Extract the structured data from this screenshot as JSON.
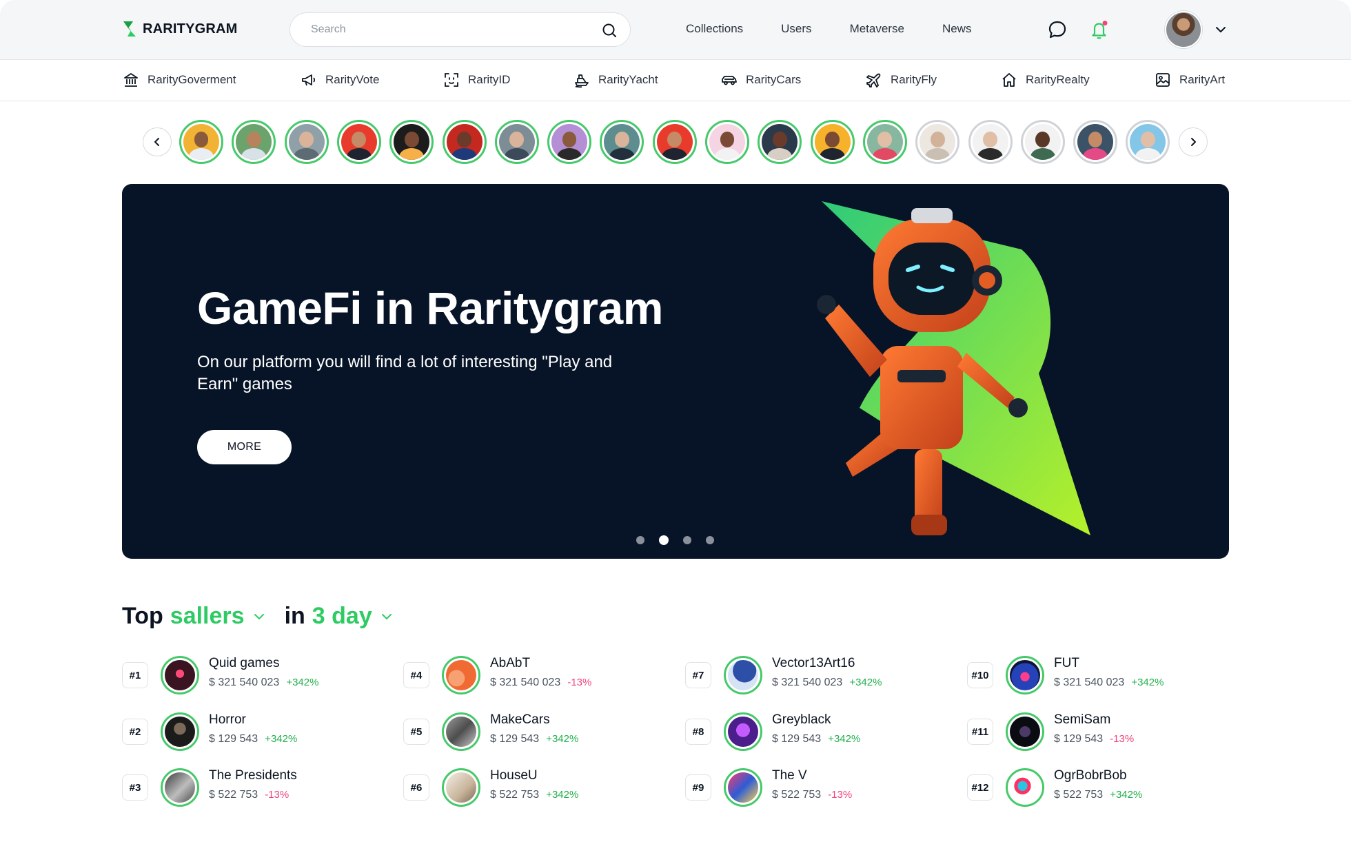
{
  "brand": {
    "name": "RARITYGRAM"
  },
  "search": {
    "placeholder": "Search"
  },
  "topnav": [
    "Collections",
    "Users",
    "Metaverse",
    "News"
  ],
  "categories": [
    {
      "label": "RarityGoverment",
      "icon": "bank-icon"
    },
    {
      "label": "RarityVote",
      "icon": "megaphone-icon"
    },
    {
      "label": "RarityID",
      "icon": "face-id-icon"
    },
    {
      "label": "RarityYacht",
      "icon": "yacht-icon"
    },
    {
      "label": "RarityCars",
      "icon": "car-icon"
    },
    {
      "label": "RarityFly",
      "icon": "plane-icon"
    },
    {
      "label": "RarityRealty",
      "icon": "house-icon"
    },
    {
      "label": "RarityArt",
      "icon": "picture-icon"
    }
  ],
  "stories_count": 19,
  "hero": {
    "title": "GameFi in Raritygram",
    "subtitle": "On our platform you will find a lot of interesting \"Play and Earn\" games",
    "button": "MORE",
    "slides": 4,
    "active_slide": 2
  },
  "top_sellers": {
    "title_prefix": "Top",
    "title_filter": "sallers",
    "period_prefix": "in",
    "period_filter": "3 day",
    "sellers": [
      {
        "rank": "#1",
        "name": "Quid games",
        "amount": "$ 321 540 023",
        "change": "+342%"
      },
      {
        "rank": "#2",
        "name": "Horror",
        "amount": "$ 129 543",
        "change": "+342%"
      },
      {
        "rank": "#3",
        "name": "The Presidents",
        "amount": "$ 522 753",
        "change": "-13%"
      },
      {
        "rank": "#4",
        "name": "AbAbT",
        "amount": "$ 321 540 023",
        "change": "-13%"
      },
      {
        "rank": "#5",
        "name": "MakeCars",
        "amount": "$ 129 543",
        "change": "+342%"
      },
      {
        "rank": "#6",
        "name": "HouseU",
        "amount": "$ 522 753",
        "change": "+342%"
      },
      {
        "rank": "#7",
        "name": "Vector13Art16",
        "amount": "$ 321 540 023",
        "change": "+342%"
      },
      {
        "rank": "#8",
        "name": "Greyblack",
        "amount": "$ 129 543",
        "change": "+342%"
      },
      {
        "rank": "#9",
        "name": "The V",
        "amount": "$ 522 753",
        "change": "-13%"
      },
      {
        "rank": "#10",
        "name": "FUT",
        "amount": "$ 321 540 023",
        "change": "+342%"
      },
      {
        "rank": "#11",
        "name": "SemiSam",
        "amount": "$ 129 543",
        "change": "-13%"
      },
      {
        "rank": "#12",
        "name": "OgrBobrBob",
        "amount": "$ 522 753",
        "change": "+342%"
      }
    ]
  },
  "colors": {
    "accent": "#2ecb63",
    "positive": "#22b04d",
    "negative": "#f0457a",
    "hero_bg": "#071428"
  }
}
